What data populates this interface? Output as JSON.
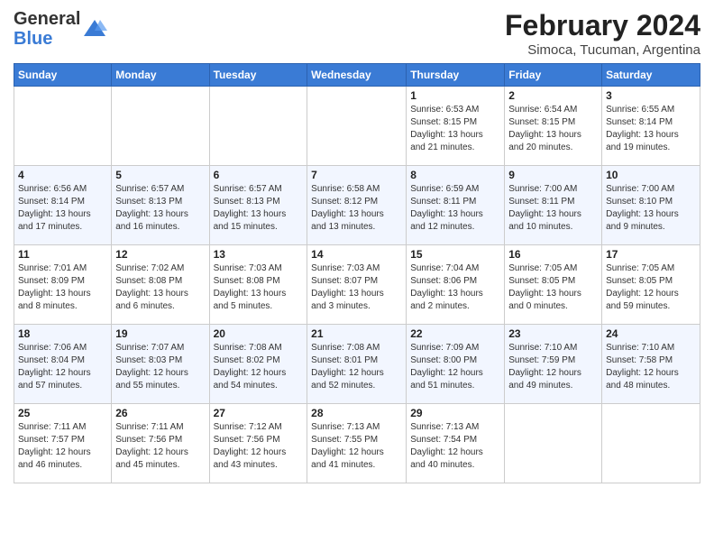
{
  "header": {
    "logo_general": "General",
    "logo_blue": "Blue",
    "month_title": "February 2024",
    "subtitle": "Simoca, Tucuman, Argentina"
  },
  "days": [
    "Sunday",
    "Monday",
    "Tuesday",
    "Wednesday",
    "Thursday",
    "Friday",
    "Saturday"
  ],
  "weeks": [
    [
      {
        "date": "",
        "info": ""
      },
      {
        "date": "",
        "info": ""
      },
      {
        "date": "",
        "info": ""
      },
      {
        "date": "",
        "info": ""
      },
      {
        "date": "1",
        "info": "Sunrise: 6:53 AM\nSunset: 8:15 PM\nDaylight: 13 hours\nand 21 minutes."
      },
      {
        "date": "2",
        "info": "Sunrise: 6:54 AM\nSunset: 8:15 PM\nDaylight: 13 hours\nand 20 minutes."
      },
      {
        "date": "3",
        "info": "Sunrise: 6:55 AM\nSunset: 8:14 PM\nDaylight: 13 hours\nand 19 minutes."
      }
    ],
    [
      {
        "date": "4",
        "info": "Sunrise: 6:56 AM\nSunset: 8:14 PM\nDaylight: 13 hours\nand 17 minutes."
      },
      {
        "date": "5",
        "info": "Sunrise: 6:57 AM\nSunset: 8:13 PM\nDaylight: 13 hours\nand 16 minutes."
      },
      {
        "date": "6",
        "info": "Sunrise: 6:57 AM\nSunset: 8:13 PM\nDaylight: 13 hours\nand 15 minutes."
      },
      {
        "date": "7",
        "info": "Sunrise: 6:58 AM\nSunset: 8:12 PM\nDaylight: 13 hours\nand 13 minutes."
      },
      {
        "date": "8",
        "info": "Sunrise: 6:59 AM\nSunset: 8:11 PM\nDaylight: 13 hours\nand 12 minutes."
      },
      {
        "date": "9",
        "info": "Sunrise: 7:00 AM\nSunset: 8:11 PM\nDaylight: 13 hours\nand 10 minutes."
      },
      {
        "date": "10",
        "info": "Sunrise: 7:00 AM\nSunset: 8:10 PM\nDaylight: 13 hours\nand 9 minutes."
      }
    ],
    [
      {
        "date": "11",
        "info": "Sunrise: 7:01 AM\nSunset: 8:09 PM\nDaylight: 13 hours\nand 8 minutes."
      },
      {
        "date": "12",
        "info": "Sunrise: 7:02 AM\nSunset: 8:08 PM\nDaylight: 13 hours\nand 6 minutes."
      },
      {
        "date": "13",
        "info": "Sunrise: 7:03 AM\nSunset: 8:08 PM\nDaylight: 13 hours\nand 5 minutes."
      },
      {
        "date": "14",
        "info": "Sunrise: 7:03 AM\nSunset: 8:07 PM\nDaylight: 13 hours\nand 3 minutes."
      },
      {
        "date": "15",
        "info": "Sunrise: 7:04 AM\nSunset: 8:06 PM\nDaylight: 13 hours\nand 2 minutes."
      },
      {
        "date": "16",
        "info": "Sunrise: 7:05 AM\nSunset: 8:05 PM\nDaylight: 13 hours\nand 0 minutes."
      },
      {
        "date": "17",
        "info": "Sunrise: 7:05 AM\nSunset: 8:05 PM\nDaylight: 12 hours\nand 59 minutes."
      }
    ],
    [
      {
        "date": "18",
        "info": "Sunrise: 7:06 AM\nSunset: 8:04 PM\nDaylight: 12 hours\nand 57 minutes."
      },
      {
        "date": "19",
        "info": "Sunrise: 7:07 AM\nSunset: 8:03 PM\nDaylight: 12 hours\nand 55 minutes."
      },
      {
        "date": "20",
        "info": "Sunrise: 7:08 AM\nSunset: 8:02 PM\nDaylight: 12 hours\nand 54 minutes."
      },
      {
        "date": "21",
        "info": "Sunrise: 7:08 AM\nSunset: 8:01 PM\nDaylight: 12 hours\nand 52 minutes."
      },
      {
        "date": "22",
        "info": "Sunrise: 7:09 AM\nSunset: 8:00 PM\nDaylight: 12 hours\nand 51 minutes."
      },
      {
        "date": "23",
        "info": "Sunrise: 7:10 AM\nSunset: 7:59 PM\nDaylight: 12 hours\nand 49 minutes."
      },
      {
        "date": "24",
        "info": "Sunrise: 7:10 AM\nSunset: 7:58 PM\nDaylight: 12 hours\nand 48 minutes."
      }
    ],
    [
      {
        "date": "25",
        "info": "Sunrise: 7:11 AM\nSunset: 7:57 PM\nDaylight: 12 hours\nand 46 minutes."
      },
      {
        "date": "26",
        "info": "Sunrise: 7:11 AM\nSunset: 7:56 PM\nDaylight: 12 hours\nand 45 minutes."
      },
      {
        "date": "27",
        "info": "Sunrise: 7:12 AM\nSunset: 7:56 PM\nDaylight: 12 hours\nand 43 minutes."
      },
      {
        "date": "28",
        "info": "Sunrise: 7:13 AM\nSunset: 7:55 PM\nDaylight: 12 hours\nand 41 minutes."
      },
      {
        "date": "29",
        "info": "Sunrise: 7:13 AM\nSunset: 7:54 PM\nDaylight: 12 hours\nand 40 minutes."
      },
      {
        "date": "",
        "info": ""
      },
      {
        "date": "",
        "info": ""
      }
    ]
  ]
}
